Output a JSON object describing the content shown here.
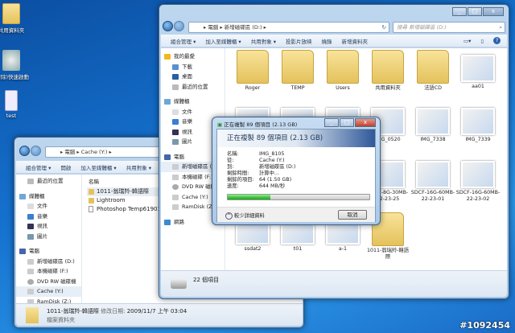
{
  "desktop": {
    "icons": [
      {
        "label": "共用資料夾"
      },
      {
        "label": "(清除)快速啟動"
      },
      {
        "label": "test"
      }
    ]
  },
  "watermark": "#1092454",
  "left_window": {
    "breadcrumb": [
      "電腦",
      "Cache (Y:)"
    ],
    "toolbar": [
      "組合管理 ▾",
      "開啟",
      "加入至媒體櫃 ▾",
      "共用對象 ▾"
    ],
    "nav": [
      {
        "label": "最近的位置"
      },
      {
        "label": "媒體櫃"
      },
      {
        "label": "文件"
      },
      {
        "label": "音樂"
      },
      {
        "label": "視訊"
      },
      {
        "label": "圖片"
      },
      {
        "label": "電腦"
      },
      {
        "label": "新增磁碟區 (D:)"
      },
      {
        "label": "本機磁碟 (F:)"
      },
      {
        "label": "DVD RW 磁碟機"
      },
      {
        "label": "Cache (Y:)"
      },
      {
        "label": "RamDisk (Z:)"
      }
    ],
    "column_header": "名稱",
    "files": [
      {
        "name": "1011-翁瑞羚-韓語際"
      },
      {
        "name": "Lightroom"
      },
      {
        "name": "Photoshop Temp619011400"
      }
    ],
    "details": {
      "name": "1011-翁瑞羚-韓語際",
      "modified_label": "修改日期:",
      "modified": "2009/11/7 上午 03:04",
      "type": "檔案資料夾"
    }
  },
  "right_window": {
    "breadcrumb": [
      "電腦",
      "新增磁碟區 (D:)"
    ],
    "search_placeholder": "搜尋 新增磁碟區 (D:)",
    "toolbar": [
      "組合管理 ▾",
      "加入至媒體櫃 ▾",
      "共用對象 ▾",
      "投影片放映",
      "燒錄",
      "新增資料夾"
    ],
    "nav": [
      {
        "label": "我的最愛"
      },
      {
        "label": "下載"
      },
      {
        "label": "桌面"
      },
      {
        "label": "最近的位置"
      },
      {
        "label": "媒體櫃"
      },
      {
        "label": "文件"
      },
      {
        "label": "音樂"
      },
      {
        "label": "視訊"
      },
      {
        "label": "圖片"
      },
      {
        "label": "電腦"
      },
      {
        "label": "新增磁碟區 (D:)"
      },
      {
        "label": "本機磁碟 (F:)"
      },
      {
        "label": "DVD RW 磁碟機"
      },
      {
        "label": "Cache (Y:)"
      },
      {
        "label": "RamDisk (Z:)"
      },
      {
        "label": "網路"
      }
    ],
    "items": [
      {
        "name": "Roger",
        "kind": "folder"
      },
      {
        "name": "TEMP",
        "kind": "folder"
      },
      {
        "name": "Users",
        "kind": "folder"
      },
      {
        "name": "共用資料夾",
        "kind": "folder"
      },
      {
        "name": "法語CD",
        "kind": "folder"
      },
      {
        "name": "aa01",
        "kind": "image"
      },
      {
        "name": "",
        "kind": "image"
      },
      {
        "name": "",
        "kind": "image"
      },
      {
        "name": "",
        "kind": "image"
      },
      {
        "name": "IMG_0520",
        "kind": "image"
      },
      {
        "name": "IMG_7338",
        "kind": "image"
      },
      {
        "name": "IMG_7339",
        "kind": "image"
      },
      {
        "name": "",
        "kind": "image"
      },
      {
        "name": "",
        "kind": "image"
      },
      {
        "name": "",
        "kind": "image"
      },
      {
        "name": "SDCF-8G-30MB-22-23-25",
        "kind": "image"
      },
      {
        "name": "SDCF-16G-60MB-22-23-01",
        "kind": "image"
      },
      {
        "name": "SDCF-16G-60MB-22-23-02",
        "kind": "image"
      },
      {
        "name": "ssdat2",
        "kind": "image"
      },
      {
        "name": "t01",
        "kind": "image"
      },
      {
        "name": "a-1",
        "kind": "image"
      },
      {
        "name": "1011-翁瑞羚-韓語際",
        "kind": "folder"
      }
    ],
    "status": "22 個項目"
  },
  "copy_dialog": {
    "title": "正在複製 89 個項目 (2.13 GB)",
    "heading": "正在複製 89 個項目 (2.13 GB)",
    "rows": [
      {
        "label": "名稱:",
        "value": "IMG_8105"
      },
      {
        "label": "從:",
        "value": "Cache (Y:)"
      },
      {
        "label": "到:",
        "value": "新增磁碟區 (D:)"
      },
      {
        "label": "剩餘時間:",
        "value": "計算中..."
      },
      {
        "label": "剩餘的項目:",
        "value": "64 (1.50 GB)"
      },
      {
        "label": "速度:",
        "value": "644 MB/秒"
      }
    ],
    "progress_percent": 30,
    "details_toggle": "較少詳細資料",
    "cancel": "取消",
    "progress_color": "#3cc43c"
  }
}
